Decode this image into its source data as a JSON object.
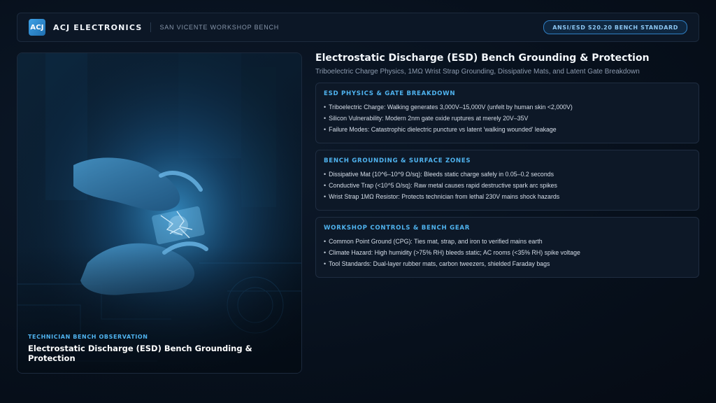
{
  "header": {
    "logo_text": "ACJ",
    "brand": "ACJ ELECTRONICS",
    "subtitle": "SAN VICENTE WORKSHOP BENCH",
    "standard_badge": "ANSI/ESD S20.20 BENCH STANDARD"
  },
  "photo": {
    "kicker": "TECHNICIAN BENCH OBSERVATION",
    "title": "Electrostatic Discharge (ESD) Bench Grounding & Protection"
  },
  "main": {
    "title": "Electrostatic Discharge (ESD) Bench Grounding & Protection",
    "tagline": "Triboelectric Charge Physics, 1MΩ Wrist Strap Grounding, Dissipative Mats, and Latent Gate Breakdown",
    "cards": [
      {
        "title": "ESD PHYSICS & GATE BREAKDOWN",
        "items": [
          "Triboelectric Charge: Walking generates 3,000V–15,000V (unfelt by human skin <2,000V)",
          "Silicon Vulnerability: Modern 2nm gate oxide ruptures at merely 20V–35V",
          "Failure Modes: Catastrophic dielectric puncture vs latent 'walking wounded' leakage"
        ]
      },
      {
        "title": "BENCH GROUNDING & SURFACE ZONES",
        "items": [
          "Dissipative Mat (10^6–10^9 Ω/sq): Bleeds static charge safely in 0.05–0.2 seconds",
          "Conductive Trap (<10^5 Ω/sq): Raw metal causes rapid destructive spark arc spikes",
          "Wrist Strap 1MΩ Resistor: Protects technician from lethal 230V mains shock hazards"
        ]
      },
      {
        "title": "WORKSHOP CONTROLS & BENCH GEAR",
        "items": [
          "Common Point Ground (CPG): Ties mat, strap, and iron to verified mains earth",
          "Climate Hazard: High humidity (>75% RH) bleeds static; AC rooms (<35% RH) spike voltage",
          "Tool Standards: Dual-layer rubber mats, carbon tweezers, shielded Faraday bags"
        ]
      }
    ]
  },
  "colors": {
    "accent": "#4fb3ef",
    "background": "#07101c",
    "card": "#0d1827"
  },
  "icons": {
    "logo": "acj-logo-icon"
  }
}
